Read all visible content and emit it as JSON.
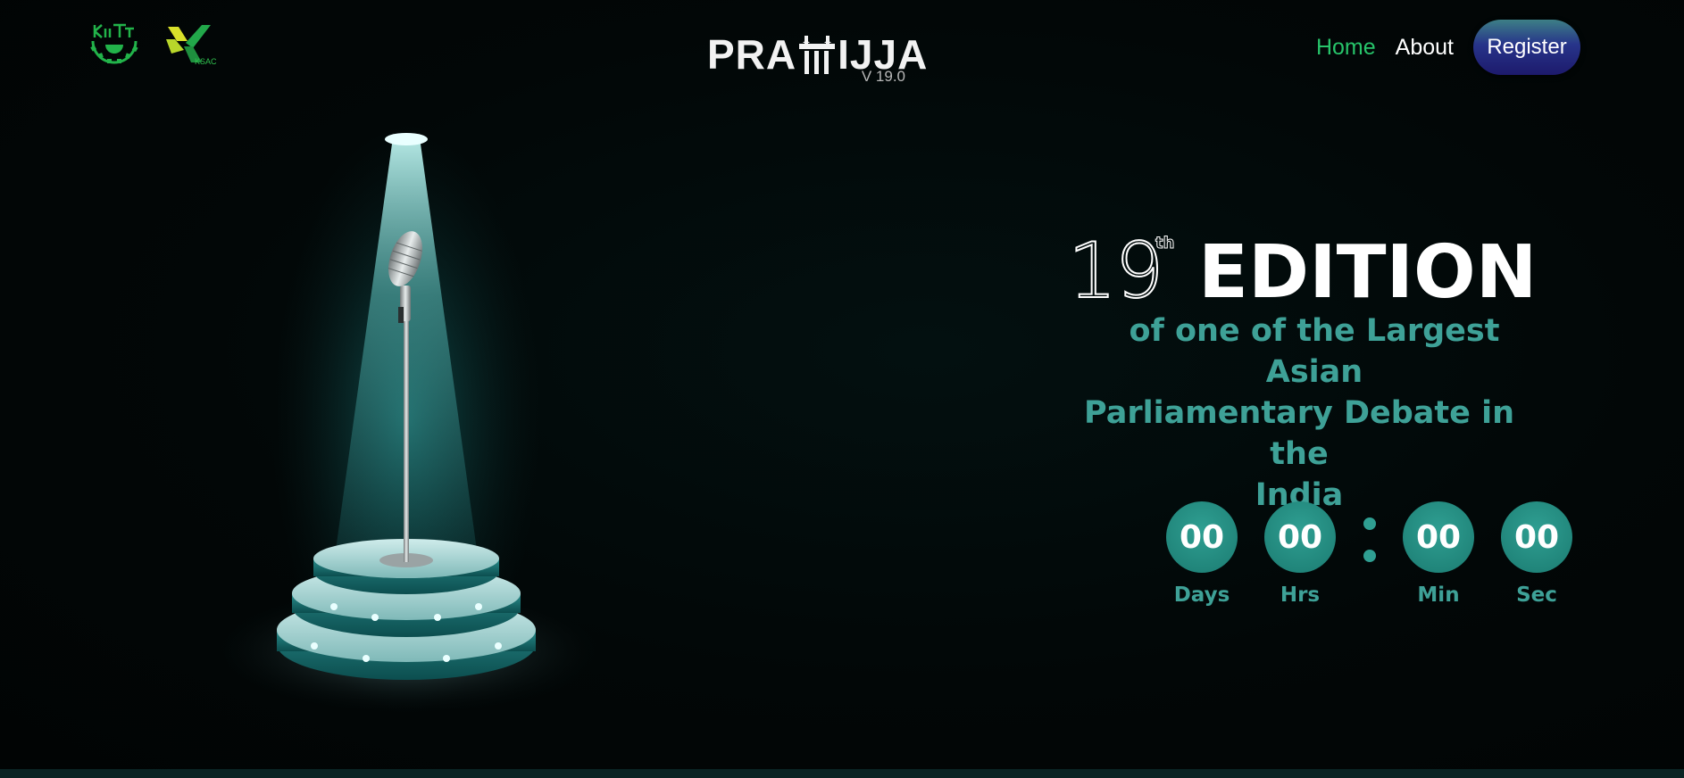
{
  "header": {
    "logos": [
      {
        "name": "KIIT",
        "icon": "kiit-gear-logo"
      },
      {
        "name": "KSAC",
        "icon": "ksac-logo"
      }
    ],
    "brand": {
      "wordmark_left": "PRA",
      "wordmark_right": "IJJA",
      "version": "V 19.0"
    },
    "nav": {
      "home_label": "Home",
      "about_label": "About",
      "register_label": "Register"
    }
  },
  "hero": {
    "edition_number": "19",
    "edition_suffix": "th",
    "edition_word": "EDITION",
    "tagline_lines": [
      "of one of the Largest Asian",
      "Parliamentary Debate in the",
      "India"
    ]
  },
  "countdown": {
    "days": "00",
    "hours": "00",
    "minutes": "00",
    "seconds": "00",
    "labels": {
      "days": "Days",
      "hours": "Hrs",
      "minutes": "Min",
      "seconds": "Sec"
    }
  },
  "colors": {
    "background": "#020707",
    "accent_teal": "#3ea197",
    "countdown_circle": "#1b7b71",
    "nav_active": "#27c46a",
    "register_gradient_top": "#3d7f86",
    "register_gradient_bottom": "#1d1a6c"
  }
}
